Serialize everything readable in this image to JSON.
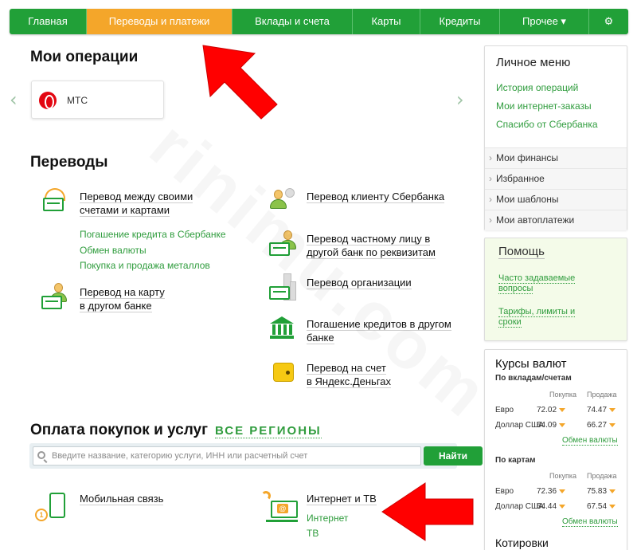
{
  "topnav": {
    "items": [
      {
        "label": "Главная",
        "active": false
      },
      {
        "label": "Переводы и платежи",
        "active": true
      },
      {
        "label": "Вклады и счета",
        "active": false
      },
      {
        "label": "Карты",
        "active": false
      },
      {
        "label": "Кредиты",
        "active": false
      },
      {
        "label": "Прочее ▾",
        "active": false
      }
    ],
    "settings_icon": "⚙",
    "accent_green": "#21a038",
    "active_orange": "#f4a62a"
  },
  "operations": {
    "title": "Мои операции",
    "prev": "‹",
    "next": "›",
    "card_label": "МТС"
  },
  "transfers": {
    "title": "Переводы",
    "own_line1": "Перевод между своими",
    "own_line2": "счетами и картами",
    "sub_links": [
      "Погашение кредита в Сбербанке",
      "Обмен валюты",
      "Покупка и продажа металлов"
    ],
    "other_bank_card_line1": "Перевод на карту",
    "other_bank_card_line2": "в другом банке",
    "sber_client": "Перевод клиенту Сбербанка",
    "private_line1": "Перевод частному лицу в",
    "private_line2": "другой банк по реквизитам",
    "organization": "Перевод организации",
    "loans_line1": "Погашение кредитов в другом",
    "loans_line2": "банке",
    "yandex_line1": "Перевод на счет",
    "yandex_line2": "в Яндекс.Деньгах"
  },
  "payments": {
    "title": "Оплата покупок и услуг",
    "regions_link": "ВСЕ РЕГИОНЫ",
    "search_placeholder": "Введите название, категорию услуги, ИНН или расчетный счет",
    "search_button": "Найти",
    "mobile": "Мобильная связь",
    "internet_tv": "Интернет и ТВ",
    "internet": "Интернет",
    "tv": "ТВ",
    "coin_text": "1"
  },
  "sidebar": {
    "personal_menu": {
      "title": "Личное меню",
      "links": [
        "История операций",
        "Мои интернет-заказы",
        "Спасибо от Сбербанка"
      ],
      "sections": [
        "Мои финансы",
        "Избранное",
        "Мои шаблоны",
        "Мои автоплатежи"
      ]
    },
    "help": {
      "title": "Помощь",
      "faq_line1": "Часто задаваемые",
      "faq_line2": "вопросы",
      "tariffs_line1": "Тарифы, лимиты и",
      "tariffs_line2": "сроки"
    },
    "rates": {
      "title": "Курсы валют",
      "deposits_label": "По вкладам/счетам",
      "cards_label": "По картам",
      "buy_header": "Покупка",
      "sell_header": "Продажа",
      "deposit_rows": [
        {
          "name": "Евро",
          "buy": "72.02",
          "sell": "74.47"
        },
        {
          "name": "Доллар США",
          "buy": "64.09",
          "sell": "66.27"
        }
      ],
      "card_rows": [
        {
          "name": "Евро",
          "buy": "72.36",
          "sell": "75.83"
        },
        {
          "name": "Доллар США",
          "buy": "64.44",
          "sell": "67.54"
        }
      ],
      "exchange_link": "Обмен валюты",
      "quotes_title": "Котировки"
    }
  },
  "watermark": "rinimu.com"
}
